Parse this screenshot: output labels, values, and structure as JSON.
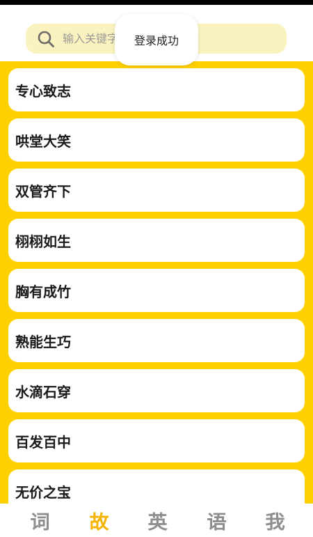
{
  "search": {
    "placeholder": "输入关键字"
  },
  "toast": {
    "text": "登录成功"
  },
  "idioms": [
    {
      "label": "专心致志"
    },
    {
      "label": "哄堂大笑"
    },
    {
      "label": "双管齐下"
    },
    {
      "label": "栩栩如生"
    },
    {
      "label": "胸有成竹"
    },
    {
      "label": "熟能生巧"
    },
    {
      "label": "水滴石穿"
    },
    {
      "label": "百发百中"
    },
    {
      "label": "无价之宝"
    }
  ],
  "tabs": [
    {
      "label": "词",
      "active": false
    },
    {
      "label": "故",
      "active": true
    },
    {
      "label": "英",
      "active": false
    },
    {
      "label": "语",
      "active": false
    },
    {
      "label": "我",
      "active": false
    }
  ],
  "colors": {
    "list_background": "#fed000",
    "search_background": "#fbf3bf",
    "active_tab": "#f5b400",
    "inactive_tab": "#8e8e8e"
  }
}
